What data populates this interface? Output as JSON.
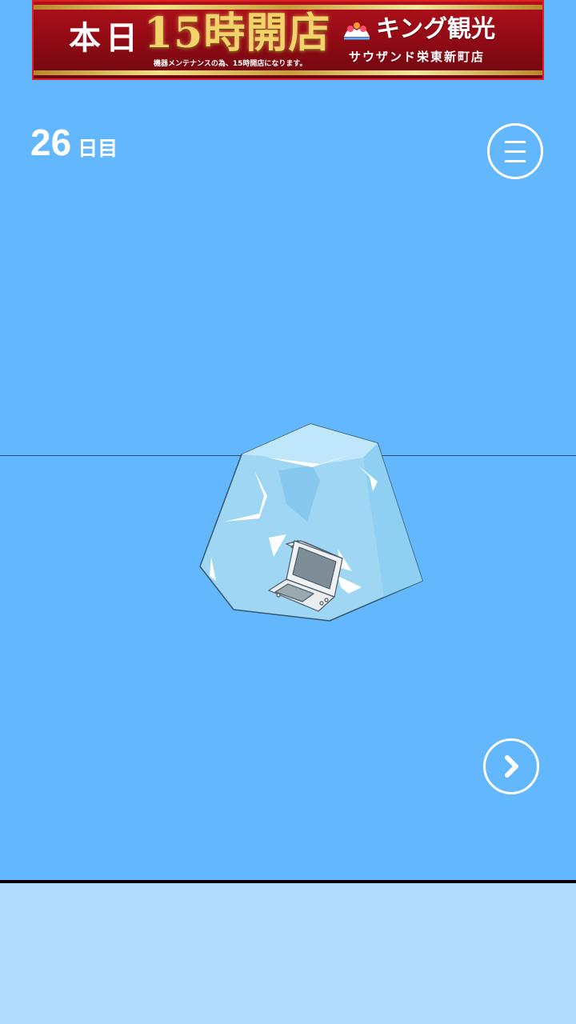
{
  "ad": {
    "left_text": "本日",
    "headline": "15時開店",
    "subtext": "機器メンテナンスの為、15時開店になります。",
    "brand": "キング観光",
    "store": "サウザンド栄東新町店",
    "colors": {
      "background": "#9e0c16",
      "gold": "#f2d36b",
      "border": "#e02020"
    }
  },
  "header": {
    "day_number": "26",
    "day_suffix": "日目",
    "menu_icon": "hamburger-icon"
  },
  "scene": {
    "item": "handheld-game-console-in-ice",
    "colors": {
      "sky": "#63b7fd",
      "ice": "#9fd6f4",
      "panel": "#b2dcfe"
    }
  },
  "controls": {
    "next_icon": "chevron-right-icon"
  }
}
